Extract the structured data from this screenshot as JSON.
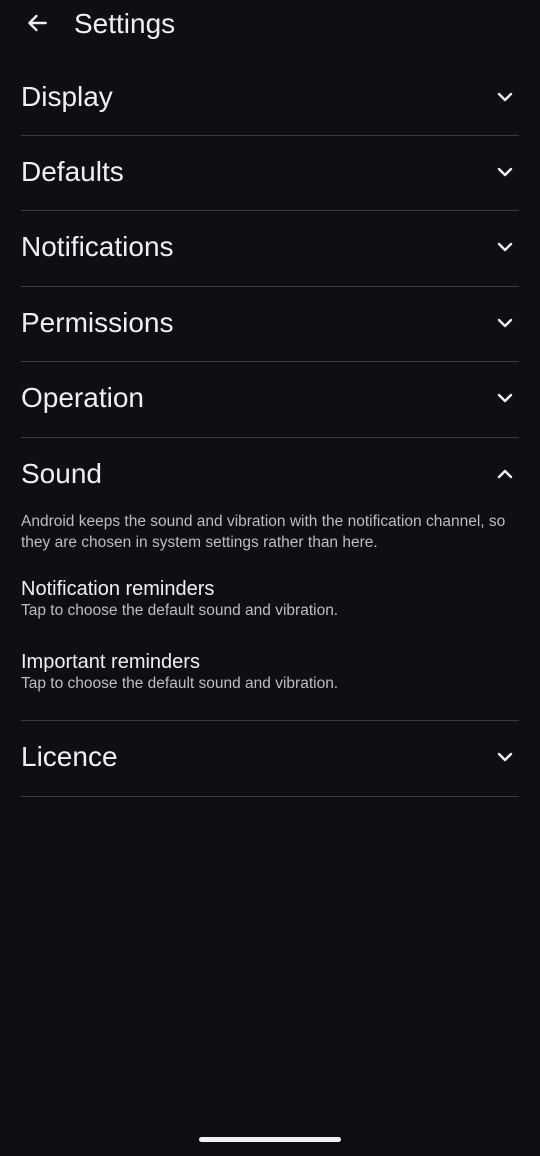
{
  "header": {
    "title": "Settings",
    "back_icon": "arrow-left-icon"
  },
  "sections": [
    {
      "label": "Display",
      "expanded": false
    },
    {
      "label": "Defaults",
      "expanded": false
    },
    {
      "label": "Notifications",
      "expanded": false
    },
    {
      "label": "Permissions",
      "expanded": false
    },
    {
      "label": "Operation",
      "expanded": false
    },
    {
      "label": "Sound",
      "expanded": true
    },
    {
      "label": "Licence",
      "expanded": false
    }
  ],
  "sound": {
    "description": "Android keeps the sound and vibration with the notification channel, so they are chosen in system settings rather than here.",
    "items": [
      {
        "title": "Notification reminders",
        "caption": "Tap to choose the default sound and vibration."
      },
      {
        "title": "Important reminders",
        "caption": "Tap to choose the default sound and vibration."
      }
    ]
  },
  "colors": {
    "background": "#0e0f13",
    "text": "#f0f0f4",
    "secondary_text": "#bdbdc3",
    "divider": "#3a3b40"
  }
}
